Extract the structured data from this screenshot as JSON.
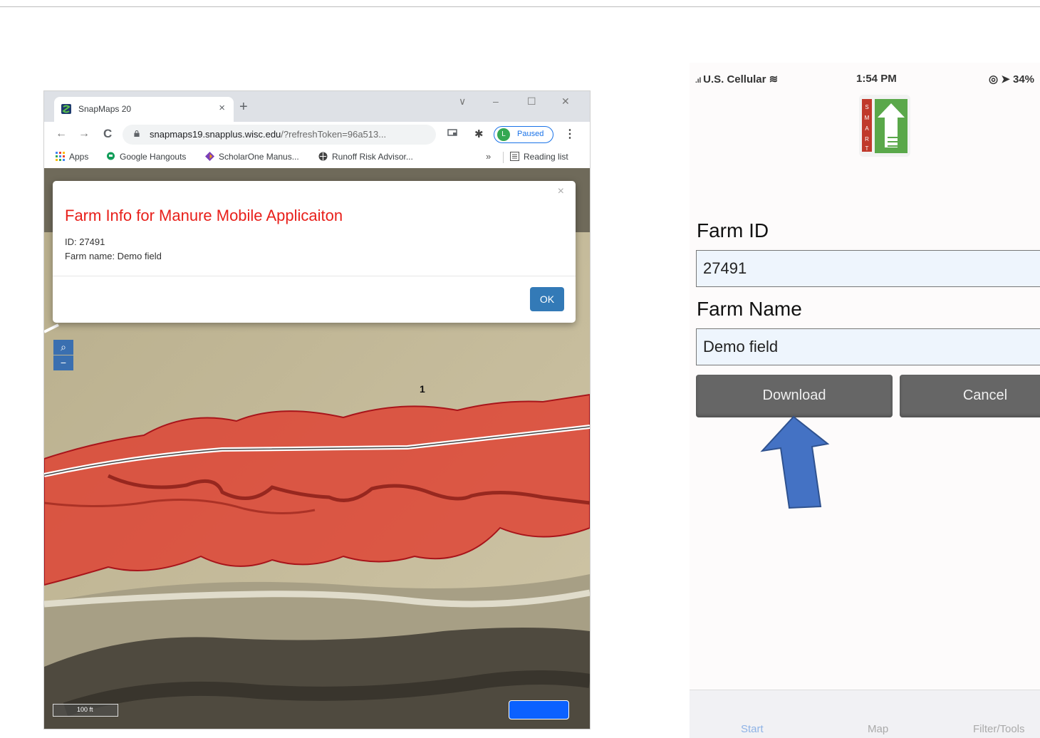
{
  "browser": {
    "tab_title": "SnapMaps 20",
    "tab_close": "×",
    "new_tab": "+",
    "window_controls": [
      "∨",
      "–",
      "☐",
      "✕"
    ],
    "nav": {
      "back": "←",
      "forward": "→",
      "reload": "C"
    },
    "url_host": "snapmaps19.snapplus.wisc.edu",
    "url_path": "/?refreshToken=96a513...",
    "star": "☆",
    "profile_initial": "L",
    "profile_status": "Paused",
    "menu": "⋮",
    "bookmarks": [
      "Apps",
      "Google Hangouts",
      "ScholarOne Manus...",
      "Runoff Risk Advisor..."
    ],
    "bookmarks_more": "»",
    "reading_list": "Reading list"
  },
  "modal": {
    "close": "×",
    "title": "Farm Info for Manure Mobile Applicaiton",
    "id_line": "ID: 27491",
    "name_line": "Farm name: Demo field",
    "ok_label": "OK"
  },
  "map": {
    "zoom_in": "⌕",
    "zoom_out": "−",
    "field_label": "1",
    "scale_label": "100 ft"
  },
  "phone": {
    "carrier": "U.S. Cellular",
    "time": "1:54 PM",
    "battery": "34%",
    "farm_id_label": "Farm ID",
    "farm_id_value": "27491",
    "farm_name_label": "Farm Name",
    "farm_name_value": "Demo field",
    "download_label": "Download",
    "cancel_label": "Cancel",
    "tabs": [
      "Start",
      "Map",
      "Filter/Tools"
    ]
  },
  "colors": {
    "buffer_fill": "#e03a2c",
    "modal_title": "#e8201b",
    "ok_button": "#337ab7",
    "arrow": "#4472c4"
  }
}
